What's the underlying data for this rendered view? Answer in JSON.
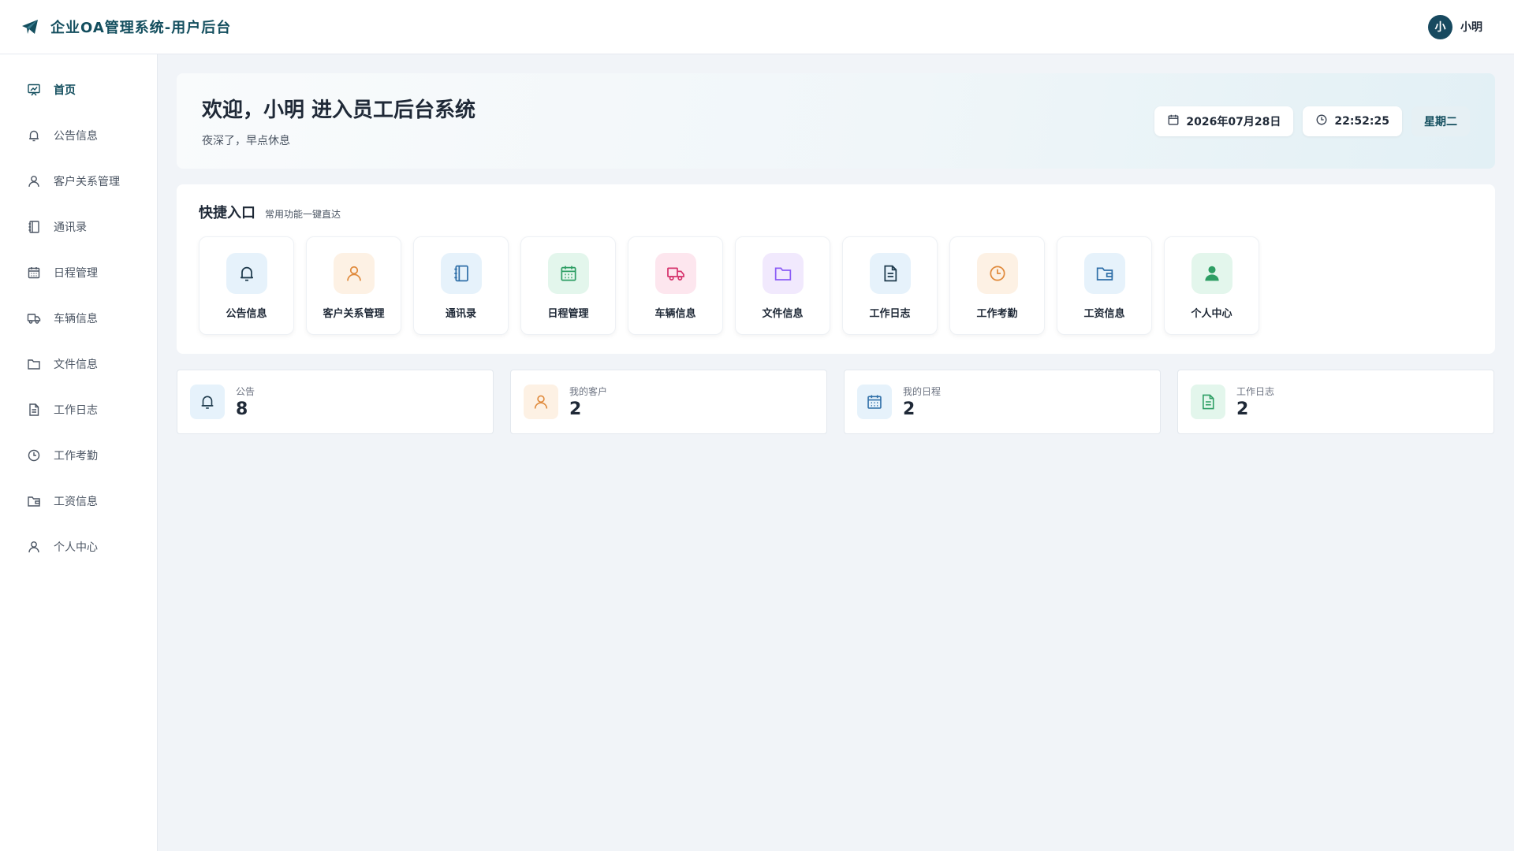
{
  "header": {
    "title": "企业OA管理系统-用户后台",
    "avatar_text": "小",
    "user_name": "小明"
  },
  "sidebar": {
    "items": [
      {
        "label": "首页",
        "icon": "dashboard-icon"
      },
      {
        "label": "公告信息",
        "icon": "bell-icon"
      },
      {
        "label": "客户关系管理",
        "icon": "user-icon"
      },
      {
        "label": "通讯录",
        "icon": "address-book-icon"
      },
      {
        "label": "日程管理",
        "icon": "calendar-icon"
      },
      {
        "label": "车辆信息",
        "icon": "truck-icon"
      },
      {
        "label": "文件信息",
        "icon": "folder-icon"
      },
      {
        "label": "工作日志",
        "icon": "document-icon"
      },
      {
        "label": "工作考勤",
        "icon": "clock-icon"
      },
      {
        "label": "工资信息",
        "icon": "wallet-icon"
      },
      {
        "label": "个人中心",
        "icon": "user-icon"
      }
    ]
  },
  "welcome": {
    "title": "欢迎，小明 进入员工后台系统",
    "subtitle": "夜深了，早点休息",
    "date": "2026年07月28日",
    "time": "22:52:25",
    "weekday": "星期二"
  },
  "quick": {
    "title": "快捷入口",
    "subtitle": "常用功能一键直达",
    "items": [
      {
        "label": "公告信息",
        "icon": "bell-icon",
        "color": "#1e3a4c",
        "bg": "#e6f2fb"
      },
      {
        "label": "客户关系管理",
        "icon": "user-icon",
        "color": "#e08a3c",
        "bg": "#fdf1e4"
      },
      {
        "label": "通讯录",
        "icon": "address-book-icon",
        "color": "#2f6fa8",
        "bg": "#e6f2fb"
      },
      {
        "label": "日程管理",
        "icon": "calendar-icon",
        "color": "#2e9e64",
        "bg": "#e3f6ec"
      },
      {
        "label": "车辆信息",
        "icon": "truck-icon",
        "color": "#d6336c",
        "bg": "#fde6ee"
      },
      {
        "label": "文件信息",
        "icon": "folder-icon",
        "color": "#8b5cf6",
        "bg": "#f1e9fd"
      },
      {
        "label": "工作日志",
        "icon": "document-icon",
        "color": "#1e3a4c",
        "bg": "#e6f2fb"
      },
      {
        "label": "工作考勤",
        "icon": "clock-icon",
        "color": "#e08a3c",
        "bg": "#fdf1e4"
      },
      {
        "label": "工资信息",
        "icon": "wallet-icon",
        "color": "#2f6fa8",
        "bg": "#e6f2fb"
      },
      {
        "label": "个人中心",
        "icon": "person-filled-icon",
        "color": "#2e9e64",
        "bg": "#e3f6ec"
      }
    ]
  },
  "stats": [
    {
      "label": "公告",
      "value": "8",
      "icon": "bell-icon",
      "color": "#1e3a4c",
      "bg": "#e6f2fb"
    },
    {
      "label": "我的客户",
      "value": "2",
      "icon": "user-icon",
      "color": "#e08a3c",
      "bg": "#fdf1e4"
    },
    {
      "label": "我的日程",
      "value": "2",
      "icon": "calendar-icon",
      "color": "#2f6fa8",
      "bg": "#e6f2fb"
    },
    {
      "label": "工作日志",
      "value": "2",
      "icon": "document-icon",
      "color": "#2e9e64",
      "bg": "#e3f6ec"
    }
  ]
}
